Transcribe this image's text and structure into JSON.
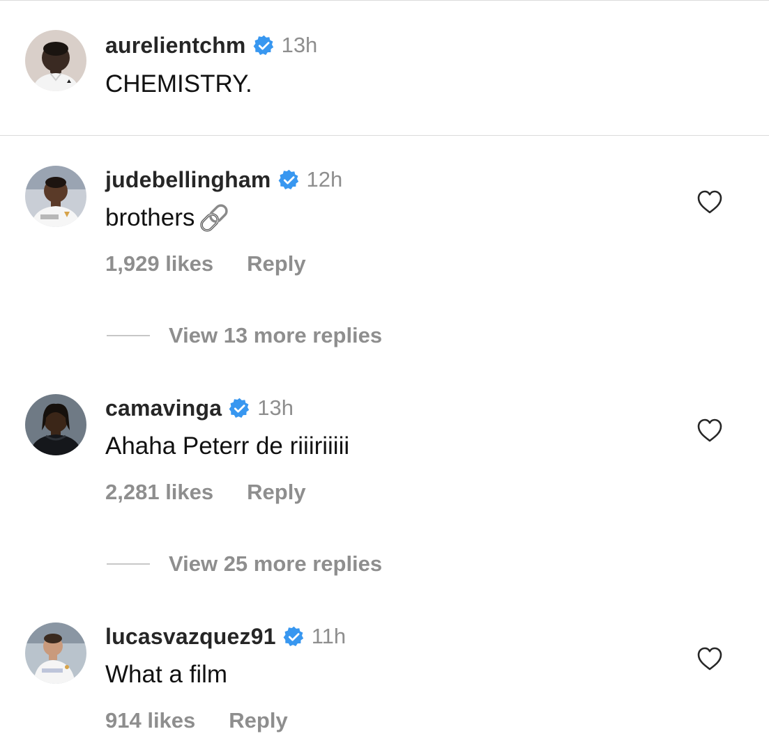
{
  "caption": {
    "username": "aurelientchm",
    "verified": true,
    "time": "13h",
    "text": "CHEMISTRY."
  },
  "comments": [
    {
      "username": "judebellingham",
      "verified": true,
      "time": "12h",
      "text": "brothers",
      "emoji": "link-icon",
      "likes": "1,929 likes",
      "reply_label": "Reply",
      "more_replies": "View 13 more replies"
    },
    {
      "username": "camavinga",
      "verified": true,
      "time": "13h",
      "text": "Ahaha Peterr de riiiriiiii",
      "likes": "2,281 likes",
      "reply_label": "Reply",
      "more_replies": "View 25 more replies"
    },
    {
      "username": "lucasvazquez91",
      "verified": true,
      "time": "11h",
      "text": "What a film",
      "likes": "914 likes",
      "reply_label": "Reply"
    }
  ],
  "colors": {
    "verified_badge": "#3897f0",
    "muted_text": "#8e8e8e",
    "username_text": "#262626",
    "divider": "#dbdbdb"
  }
}
